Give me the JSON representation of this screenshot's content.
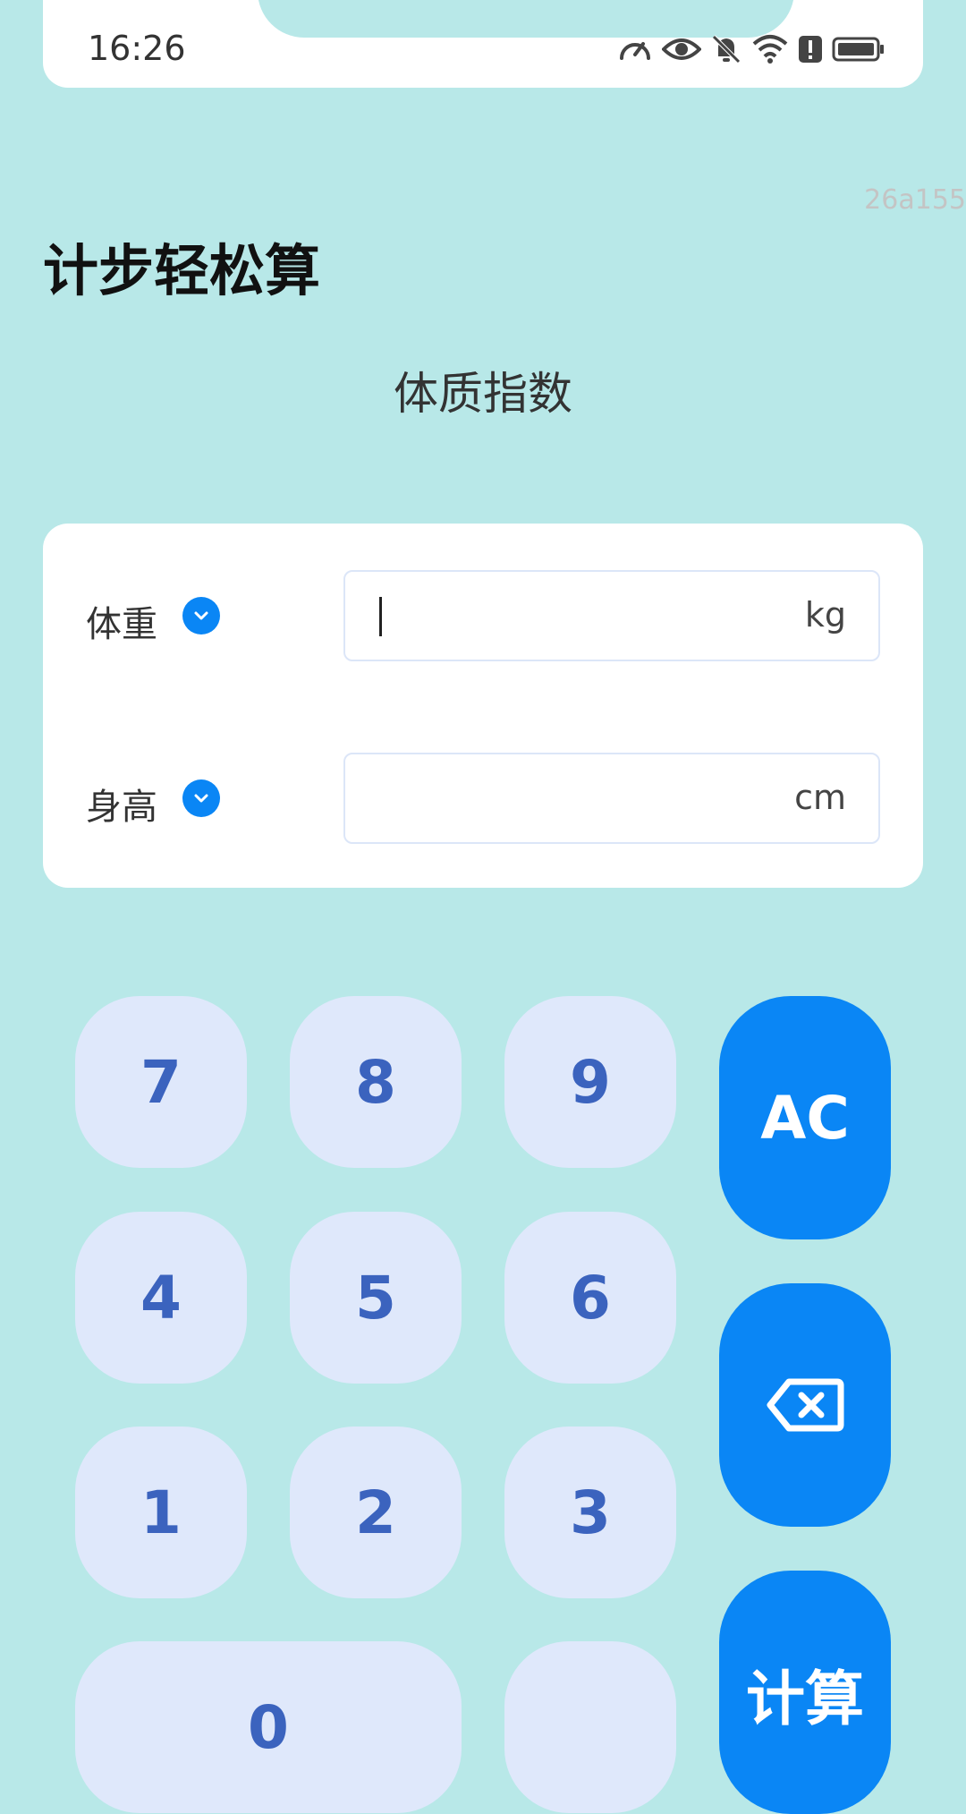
{
  "status_bar": {
    "time": "16:26",
    "icons": [
      "speedometer-icon",
      "eye-icon",
      "bell-off-icon",
      "wifi-icon",
      "alert-icon",
      "battery-icon"
    ]
  },
  "watermark": "26a155",
  "app_title": "计步轻松算",
  "page_subtitle": "体质指数",
  "fields": {
    "weight": {
      "label": "体重",
      "unit": "kg",
      "value": ""
    },
    "height": {
      "label": "身高",
      "unit": "cm",
      "value": ""
    }
  },
  "keypad": {
    "k7": "7",
    "k8": "8",
    "k9": "9",
    "k4": "4",
    "k5": "5",
    "k6": "6",
    "k1": "1",
    "k2": "2",
    "k3": "3",
    "k0": "0",
    "clear": "AC",
    "calculate": "计算"
  },
  "colors": {
    "background": "#b8e8e8",
    "accent": "#0a86f5",
    "key_fill": "#dfe8fb",
    "key_text": "#3b63be"
  }
}
